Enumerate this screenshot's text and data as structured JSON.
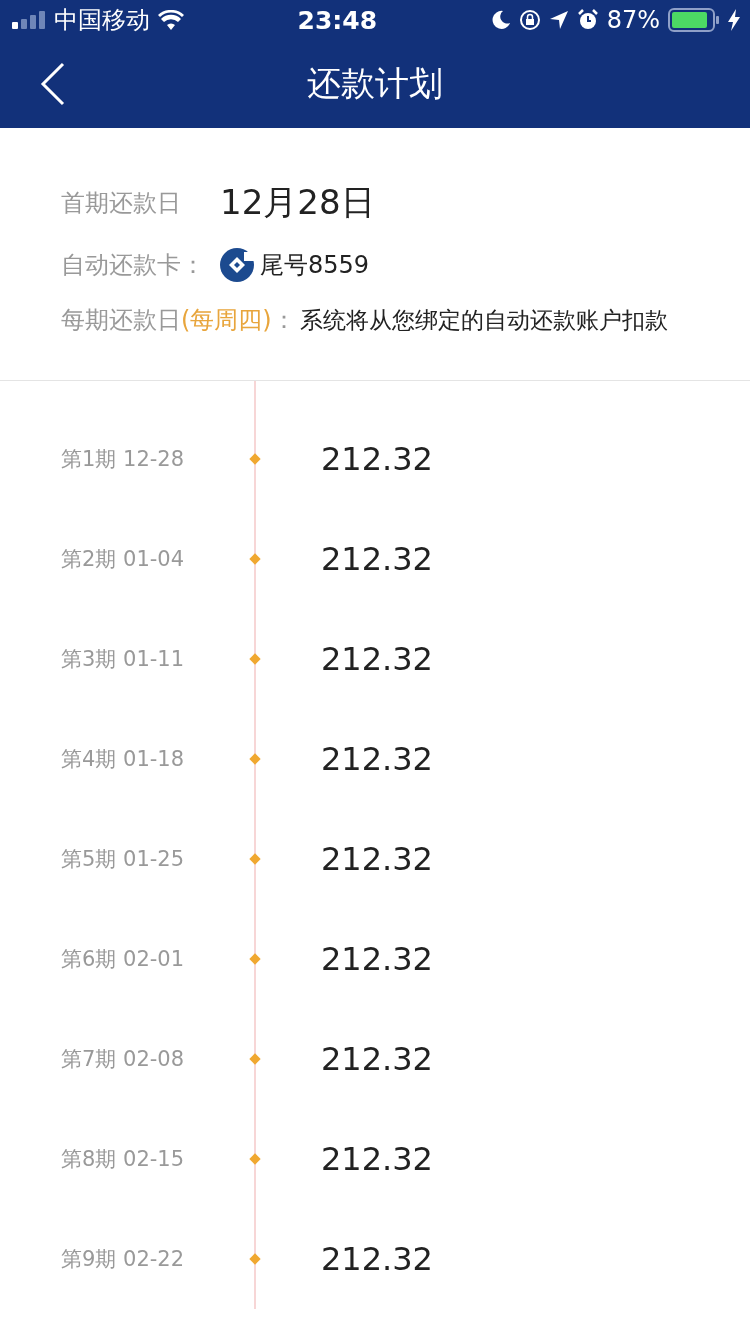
{
  "status_bar": {
    "carrier": "中国移动",
    "time": "23:48",
    "battery": "87%"
  },
  "nav": {
    "title": "还款计划"
  },
  "info": {
    "first_date_label": "首期还款日",
    "first_date": "12月28日",
    "card_label": "自动还款卡：",
    "card": "尾号8559",
    "period_label": "每期还款日",
    "period_note": "(每周四)",
    "period_colon": "：",
    "period_text": "系统将从您绑定的自动还款账户扣款"
  },
  "schedule": [
    {
      "period": "第1期 12-28",
      "amount": "212.32"
    },
    {
      "period": "第2期 01-04",
      "amount": "212.32"
    },
    {
      "period": "第3期 01-11",
      "amount": "212.32"
    },
    {
      "period": "第4期 01-18",
      "amount": "212.32"
    },
    {
      "period": "第5期 01-25",
      "amount": "212.32"
    },
    {
      "period": "第6期 02-01",
      "amount": "212.32"
    },
    {
      "period": "第7期 02-08",
      "amount": "212.32"
    },
    {
      "period": "第8期 02-15",
      "amount": "212.32"
    },
    {
      "period": "第9期 02-22",
      "amount": "212.32"
    }
  ]
}
